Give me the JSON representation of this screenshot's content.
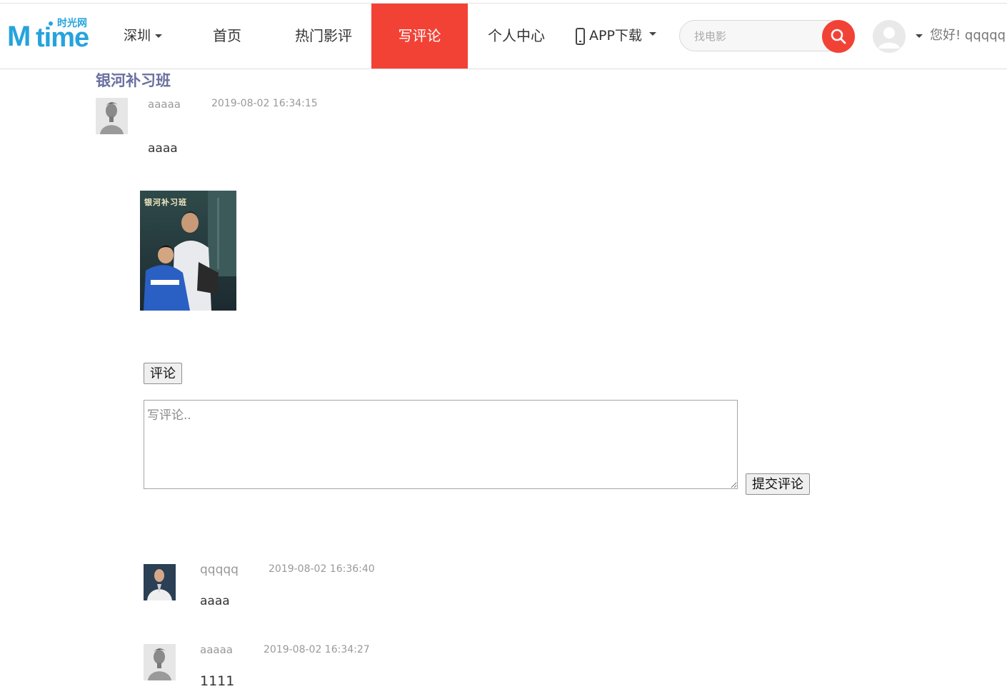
{
  "header": {
    "logo": {
      "brand": "Mtime",
      "m": "M",
      "time": "time",
      "cn": "时光网"
    },
    "city": "深圳",
    "nav": [
      {
        "label": "首页"
      },
      {
        "label": "热门影评"
      },
      {
        "label": "写评论",
        "active": true
      },
      {
        "label": "个人中心"
      }
    ],
    "app_download": "APP下载",
    "search": {
      "placeholder": "找电影"
    },
    "greeting": "您好! qqqqq",
    "accent_color": "#f24236"
  },
  "review": {
    "movie_title": "银河补习班",
    "author": "aaaaa",
    "time": "2019-08-02 16:34:15",
    "content": "aaaa",
    "poster_title": "银河补习班"
  },
  "comment_form": {
    "toggle_label": "评论",
    "placeholder": "写评论..",
    "submit_label": "提交评论"
  },
  "comments": [
    {
      "author": "qqqqq",
      "time": "2019-08-02 16:36:40",
      "content": "aaaa"
    },
    {
      "author": "aaaaa",
      "time": "2019-08-02 16:34:27",
      "content": "1111"
    }
  ]
}
